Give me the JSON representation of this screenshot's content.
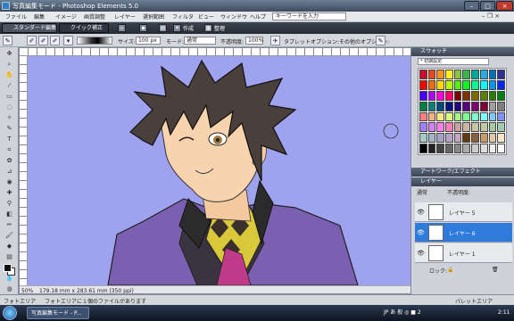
{
  "window": {
    "title": "写真編集モード - Photoshop Elements 5.0"
  },
  "menu": {
    "items": [
      "ファイル",
      "編集",
      "イメージ",
      "画質調整",
      "レイヤー",
      "選択範囲",
      "フィルタ",
      "ビュー",
      "ウィンドウ",
      "ヘルプ"
    ],
    "search_placeholder": "キーワードを入力"
  },
  "shortcuts": {
    "standard_edit": "スタンダード編集",
    "quick_fix": "クイック補正",
    "create": "作成",
    "organize": "整理"
  },
  "options": {
    "size_label": "サイズ:",
    "size_value": "100 px",
    "mode_label": "モード:",
    "mode_value": "通常",
    "opacity_label": "不透明度:",
    "opacity_value": "100%",
    "tablet_label": "タブレットオプション:",
    "other_label": "その他のオプション:"
  },
  "document": {
    "zoom": "50%",
    "size_info": "179.18 mm x 283.61 mm (350 ppi)"
  },
  "palette": {
    "swatches_title": "スウォッチ",
    "swatch_set": "* 初期設定",
    "artwork_title": "アートワーク/エフェクト",
    "layers_title": "レイヤー",
    "blend_mode": "通常",
    "opacity_label": "不透明度:",
    "lock_label": "ロック:",
    "layers": [
      {
        "name": "レイヤー 5",
        "active": false
      },
      {
        "name": "レイヤー 6",
        "active": true
      },
      {
        "name": "レイヤー 1",
        "active": false
      }
    ],
    "swatch_colors": [
      "#c8102e",
      "#e8481c",
      "#f7931e",
      "#fcee21",
      "#8cc63f",
      "#39b54a",
      "#00a99d",
      "#29abe2",
      "#0071bc",
      "#2e3192",
      "#ff0000",
      "#ff6a00",
      "#ffd800",
      "#b6ff00",
      "#4cff00",
      "#00ff21",
      "#00ff90",
      "#00ffff",
      "#0094ff",
      "#0026ff",
      "#4800ff",
      "#b200ff",
      "#ff00dc",
      "#ff006e",
      "#7f0000",
      "#7f3300",
      "#7f6a00",
      "#5b7f00",
      "#267f00",
      "#007f0e",
      "#007f46",
      "#007f7f",
      "#004a7f",
      "#00137f",
      "#21007f",
      "#57007f",
      "#7f006e",
      "#7f0037",
      "#a0a0a0",
      "#808080",
      "#ff7f7f",
      "#ffb27f",
      "#ffe97f",
      "#daff7f",
      "#a5ff7f",
      "#7fff8e",
      "#7fffc5",
      "#7fffff",
      "#7fc9ff",
      "#7f92ff",
      "#a17fff",
      "#d67fff",
      "#ff7fed",
      "#ff7fb6",
      "#c9a3a3",
      "#c9b6a3",
      "#c9c2a3",
      "#bdc9a3",
      "#a7c9a3",
      "#a3c9b4",
      "#a3c9c9",
      "#a3b6c9",
      "#a3a3c9",
      "#b6a3c9",
      "#c9a3c2",
      "#603913",
      "#8b5e3c",
      "#c69c6d",
      "#e0c9a6",
      "#f5e6c8",
      "#000000",
      "#222222",
      "#444444",
      "#666666",
      "#888888",
      "#aaaaaa",
      "#cccccc",
      "#dddddd",
      "#eeeeee",
      "#ffffff"
    ]
  },
  "status": {
    "left": "フォトエリア",
    "hint": "フォトエリアに１個のファイルがあります",
    "right": "パレットエリア"
  },
  "taskbar": {
    "item": "写真編集モード - P...",
    "tray": "JP あ 般 ◎ ■ 2",
    "clock": "2:11"
  }
}
